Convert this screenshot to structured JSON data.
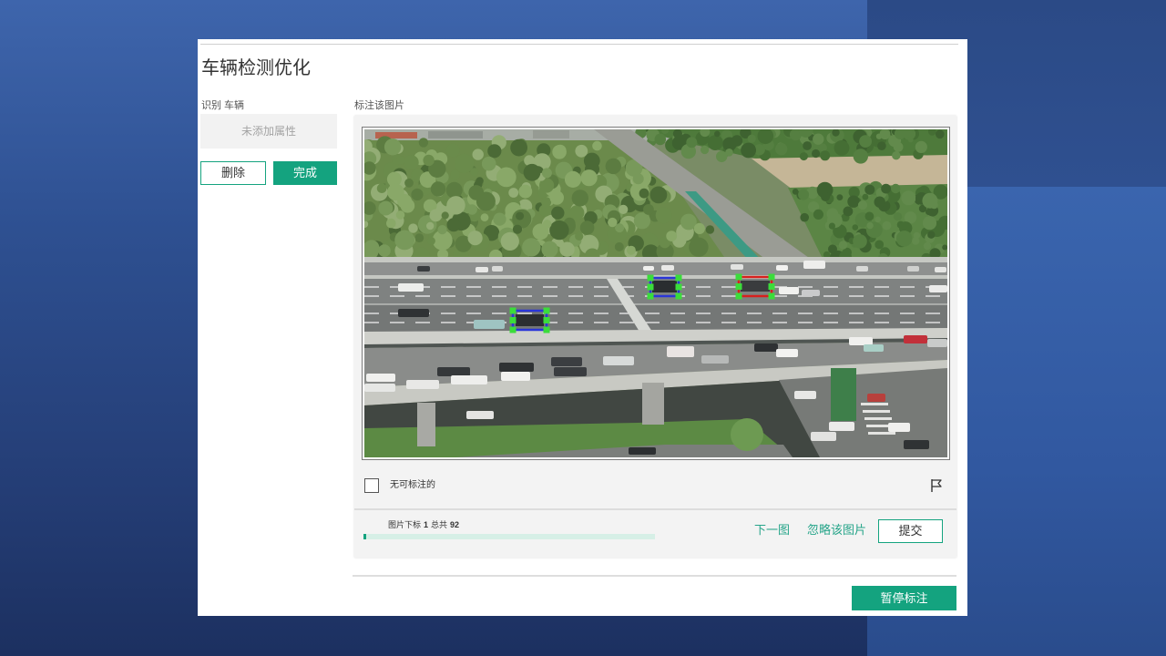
{
  "page": {
    "title": "车辆检测优化"
  },
  "sidebar": {
    "label": "识别 车辆",
    "attr_placeholder": "未添加属性",
    "delete_label": "删除",
    "done_label": "完成"
  },
  "annotate": {
    "label": "标注该图片",
    "none_label": "无可标注的",
    "none_checked": false,
    "boxes": [
      {
        "color": "#2a36d8"
      },
      {
        "color": "#d8201d"
      },
      {
        "color": "#2a36d8"
      }
    ],
    "handle_color": "#3bdc3b"
  },
  "progress": {
    "index_label": "图片下标",
    "index": "1",
    "total_label": "总共",
    "total": "92",
    "fraction": 0.0109
  },
  "actions": {
    "next_label": "下一图",
    "skip_label": "忽略该图片",
    "submit_label": "提交",
    "pause_label": "暂停标注"
  },
  "icons": {
    "flag": "flag-icon",
    "checkbox": "checkbox-icon"
  },
  "colors": {
    "accent": "#14a37f",
    "link": "#27a58a",
    "progress_track": "#d6efe6"
  }
}
